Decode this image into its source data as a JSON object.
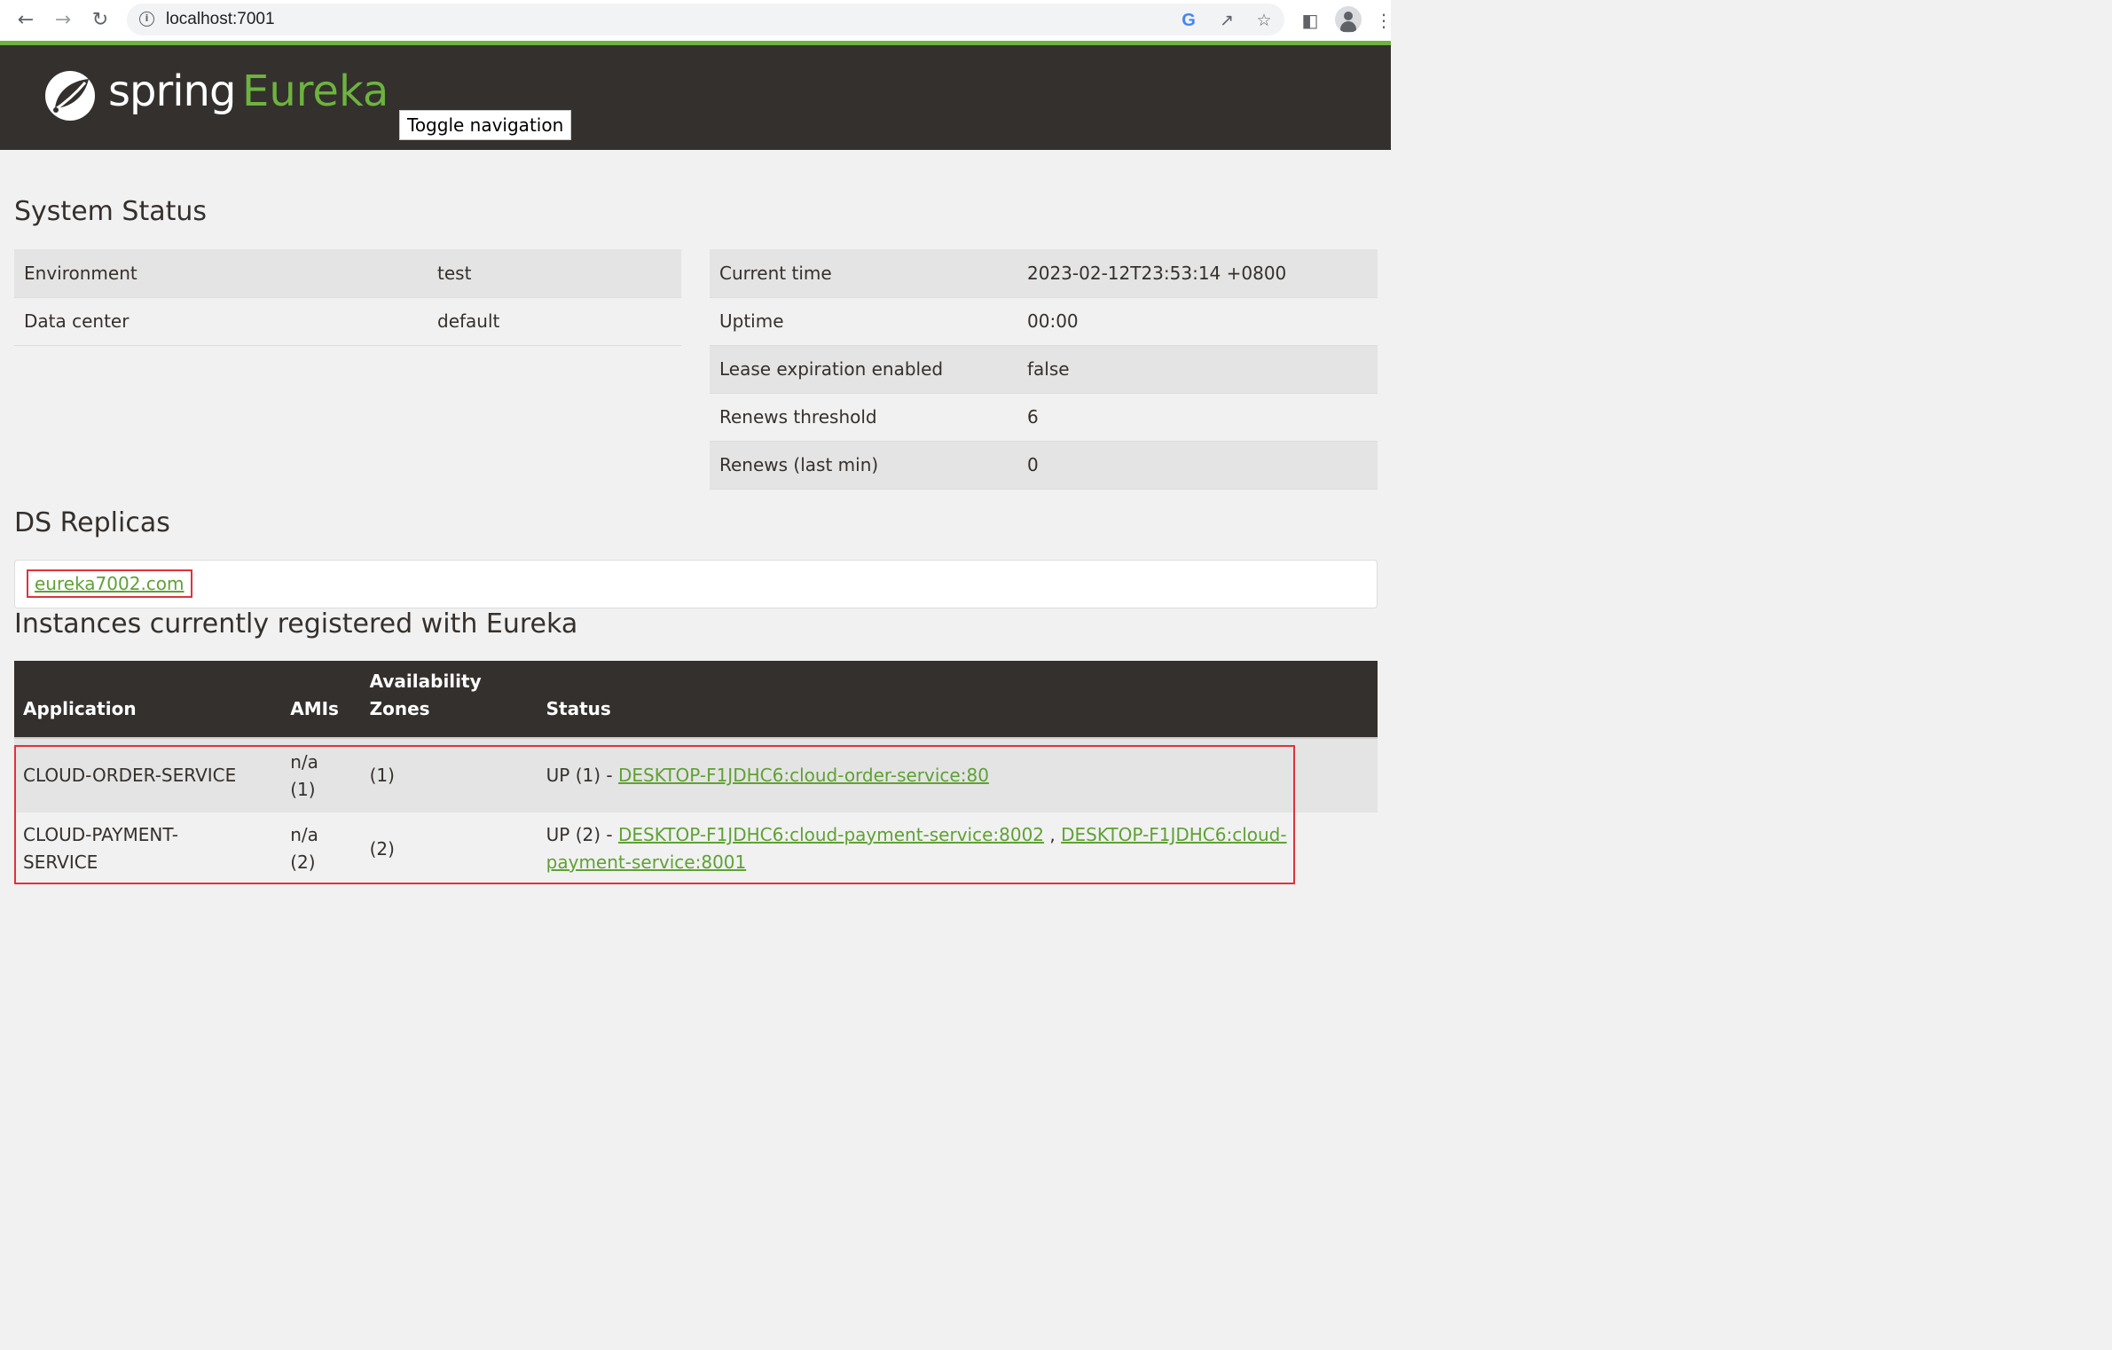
{
  "browser": {
    "url": "localhost:7001",
    "icons": [
      "back-arrow-icon",
      "forward-arrow-icon",
      "reload-icon",
      "site-info-icon",
      "google-icon",
      "share-icon",
      "bookmark-star-icon",
      "side-panel-icon",
      "profile-avatar-icon",
      "kebab-menu-icon"
    ]
  },
  "header": {
    "logo_spring": "spring",
    "logo_eureka": "Eureka",
    "toggle_label": "Toggle navigation",
    "colors": {
      "bar": "#34302d",
      "brand_green": "#6db33f",
      "accent_strip": "#6db33f"
    }
  },
  "system_status": {
    "title": "System Status",
    "left": [
      {
        "key": "Environment",
        "value": "test"
      },
      {
        "key": "Data center",
        "value": "default"
      }
    ],
    "right": [
      {
        "key": "Current time",
        "value": "2023-02-12T23:53:14 +0800"
      },
      {
        "key": "Uptime",
        "value": "00:00"
      },
      {
        "key": "Lease expiration enabled",
        "value": "false"
      },
      {
        "key": "Renews threshold",
        "value": "6"
      },
      {
        "key": "Renews (last min)",
        "value": "0"
      }
    ]
  },
  "replicas": {
    "title": "DS Replicas",
    "items": [
      "eureka7002.com"
    ]
  },
  "instances": {
    "title": "Instances currently registered with Eureka",
    "columns": [
      "Application",
      "AMIs",
      "Availability Zones",
      "Status"
    ],
    "rows": [
      {
        "application": "CLOUD-ORDER-SERVICE",
        "amis": "n/a (1)",
        "zones": "(1)",
        "status_prefix": "UP (1) - ",
        "links": [
          "DESKTOP-F1JDHC6:cloud-order-service:80"
        ]
      },
      {
        "application": "CLOUD-PAYMENT-SERVICE",
        "amis": "n/a (2)",
        "zones": "(2)",
        "status_prefix": "UP (2) - ",
        "links": [
          "DESKTOP-F1JDHC6:cloud-payment-service:8002",
          "DESKTOP-F1JDHC6:cloud-payment-service:8001"
        ],
        "link_separator": " , "
      }
    ]
  },
  "highlight_color": "#e0323c"
}
